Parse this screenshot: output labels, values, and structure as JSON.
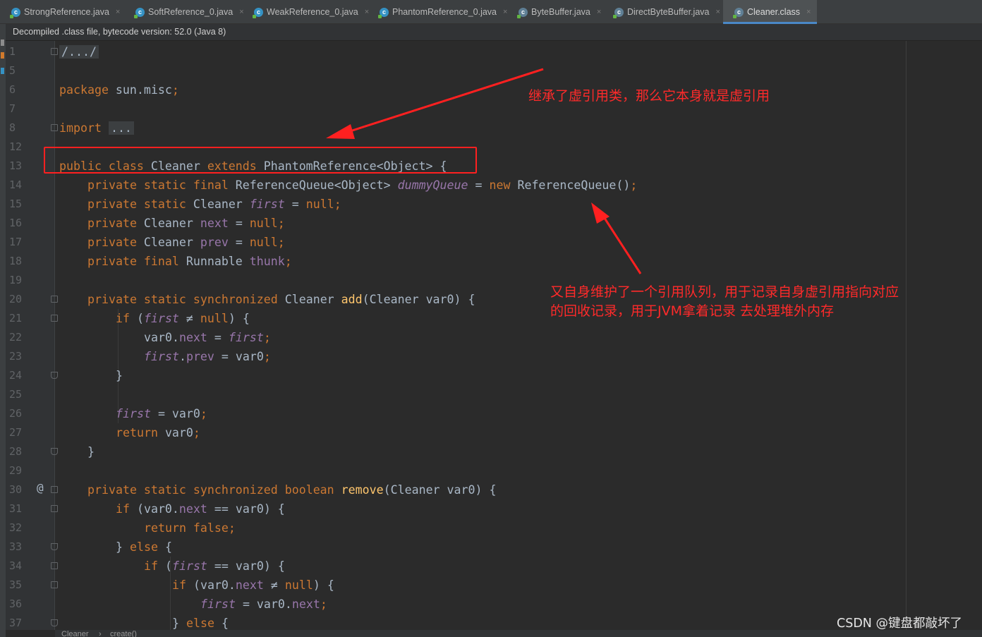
{
  "editor": {
    "tabs": [
      {
        "label": "StrongReference.java",
        "icon": "java-class-icon",
        "active": false
      },
      {
        "label": "SoftReference_0.java",
        "icon": "java-class-icon",
        "active": false
      },
      {
        "label": "WeakReference_0.java",
        "icon": "java-class-icon",
        "active": false
      },
      {
        "label": "PhantomReference_0.java",
        "icon": "java-class-icon",
        "active": false
      },
      {
        "label": "ByteBuffer.java",
        "icon": "abstract-class-icon",
        "active": false
      },
      {
        "label": "DirectByteBuffer.java",
        "icon": "java-class-icon",
        "active": false
      },
      {
        "label": "Cleaner.class",
        "icon": "compiled-class-icon",
        "active": true
      }
    ],
    "close_glyph": "×",
    "banner": "Decompiled .class file, bytecode version: 52.0 (Java 8)",
    "line_numbers": [
      "1",
      "5",
      "6",
      "7",
      "8",
      "12",
      "13",
      "14",
      "15",
      "16",
      "17",
      "18",
      "19",
      "20",
      "21",
      "22",
      "23",
      "24",
      "25",
      "26",
      "27",
      "28",
      "29",
      "30",
      "31",
      "32",
      "33",
      "34",
      "35",
      "36",
      "37"
    ],
    "override_marker": "@",
    "code": {
      "l1": "/.../",
      "l6a": "package",
      "l6b": " sun.misc",
      "l6c": ";",
      "l8a": "import",
      "l8b": "...",
      "l13a": "public class",
      "l13b": " Cleaner ",
      "l13c": "extends",
      "l13d": " PhantomReference<Object> {",
      "l14a": "private static final",
      "l14b": " ReferenceQueue<Object> ",
      "l14c": "dummyQueue",
      "l14d": " = ",
      "l14e": "new",
      "l14f": " ReferenceQueue()",
      "l14g": ";",
      "l15a": "private static",
      "l15b": " Cleaner ",
      "l15c": "first",
      "l15d": " = ",
      "l15e": "null;",
      "l16a": "private",
      "l16b": " Cleaner ",
      "l16c": "next",
      "l16d": " = ",
      "l16e": "null;",
      "l17a": "private",
      "l17b": " Cleaner ",
      "l17c": "prev",
      "l17d": " = ",
      "l17e": "null;",
      "l18a": "private final",
      "l18b": " Runnable ",
      "l18c": "thunk",
      "l18d": ";",
      "l20a": "private static synchronized",
      "l20b": " Cleaner ",
      "l20c": "add",
      "l20d": "(Cleaner var0) {",
      "l21a": "if",
      "l21b": " (",
      "l21c": "first",
      "l21d": " ≠ ",
      "l21e": "null",
      "l21f": ") {",
      "l22a": "var0.",
      "l22b": "next",
      "l22c": " = ",
      "l22d": "first",
      "l22e": ";",
      "l23a": "first",
      "l23b": ".",
      "l23c": "prev",
      "l23d": " = var0",
      "l23e": ";",
      "l24": "}",
      "l26a": "first",
      "l26b": " = var0",
      "l26c": ";",
      "l27a": "return",
      "l27b": " var0",
      "l27c": ";",
      "l28": "}",
      "l30a": "private static synchronized boolean",
      "l30b": " ",
      "l30c": "remove",
      "l30d": "(Cleaner var0) {",
      "l31a": "if",
      "l31b": " (var0.",
      "l31c": "next",
      "l31d": " == var0) {",
      "l32a": "return false;",
      "l33a": "} ",
      "l33b": "else",
      "l33c": " {",
      "l34a": "if",
      "l34b": " (",
      "l34c": "first",
      "l34d": " == var0) {",
      "l35a": "if",
      "l35b": " (var0.",
      "l35c": "next",
      "l35d": " ≠ ",
      "l35e": "null",
      "l35f": ") {",
      "l36a": "first",
      "l36b": " = var0.",
      "l36c": "next",
      "l36d": ";",
      "l37a": "} ",
      "l37b": "else",
      "l37c": " {"
    },
    "breadcrumb": [
      "Cleaner",
      "›",
      "create()"
    ]
  },
  "annotations": {
    "note1": "继承了虚引用类，那么它本身就是虚引用",
    "note2_line1": "又自身维护了一个引用队列，用于记录自身虚引用指向对应",
    "note2_line2": "的回收记录，用于JVM拿着记录 去处理堆外内存",
    "color": "#ff2a2a"
  },
  "watermark": "CSDN @键盘都敲坏了",
  "colors": {
    "keyword": "#cc7832",
    "field": "#9876aa",
    "method": "#ffc66d",
    "text": "#a9b7c6",
    "background": "#2b2b2b",
    "active_tab_underline": "#4a88c7"
  }
}
